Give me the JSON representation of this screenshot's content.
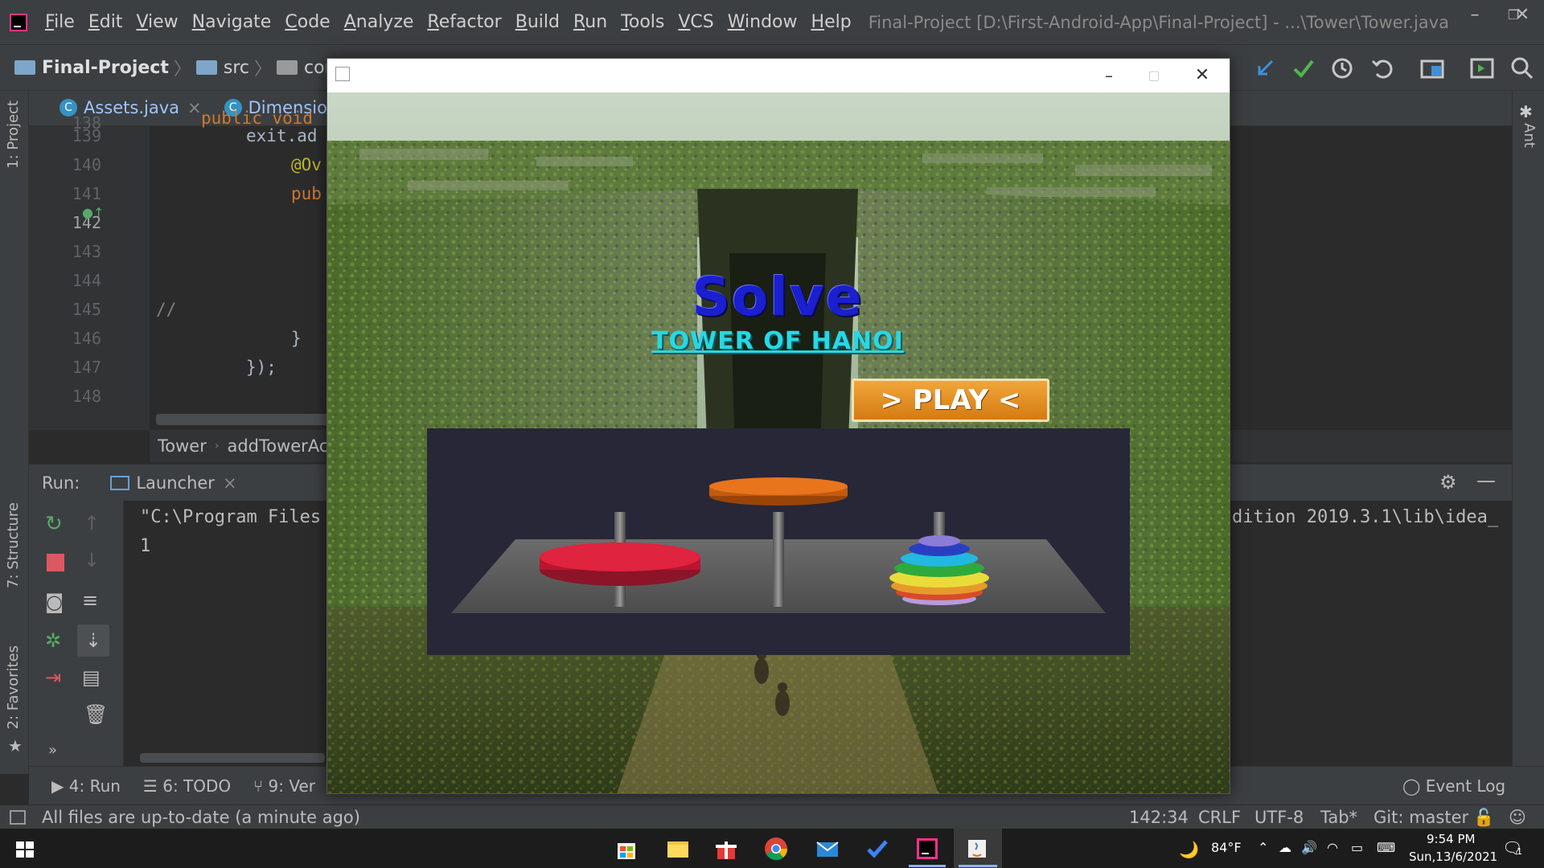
{
  "ide": {
    "menu": [
      "File",
      "Edit",
      "View",
      "Navigate",
      "Code",
      "Analyze",
      "Refactor",
      "Build",
      "Run",
      "Tools",
      "VCS",
      "Window",
      "Help"
    ],
    "window_title": "Final-Project [D:\\First-Android-App\\Final-Project] - ...\\Tower\\Tower.java",
    "breadcrumbs": [
      "Final-Project",
      "src",
      "com"
    ],
    "editor_tabs": [
      {
        "label": "Assets.java",
        "close": "×"
      },
      {
        "label": "Dimension.ja"
      }
    ],
    "line_numbers": [
      "138",
      "139",
      "140",
      "141",
      "142",
      "143",
      "144",
      "145",
      "146",
      "147",
      "148"
    ],
    "code_lines": [
      "public void",
      "exit.ad",
      "@Ov",
      "pub",
      "",
      "",
      "",
      "//",
      "}",
      "});",
      ""
    ],
    "code_breadcrumb": [
      "Tower",
      "addTowerAc"
    ],
    "run": {
      "label": "Run:",
      "config_tab": "Launcher",
      "output_line1_left": "\"C:\\Program Files",
      "output_line1_right": "dition 2019.3.1\\lib\\idea_",
      "output_line2": "1"
    },
    "tool_tabs": [
      "4: Run",
      "6: TODO",
      "9: Ver"
    ],
    "event_log": "Event Log",
    "side_labels": {
      "project": "1: Project",
      "structure": "7: Structure",
      "favorites": "2: Favorites",
      "ant": "Ant"
    },
    "status": {
      "message": "All files are up-to-date (a minute ago)",
      "position": "142:34",
      "line_sep": "CRLF",
      "encoding": "UTF-8",
      "indent": "Tab*",
      "git": "Git: master"
    }
  },
  "game": {
    "title": "Solve",
    "subtitle": "TOWER OF HANOI",
    "play_label": "> PLAY <",
    "disc_colors": {
      "left_disc": "#d81e3c",
      "top_disc": "#e06a14",
      "stack": [
        "#8d7cd6",
        "#2a3fbf",
        "#22b8e0",
        "#2eaa3c",
        "#e8dc3a",
        "#e69a2a",
        "#d84a2a",
        "#b89adf"
      ]
    }
  },
  "taskbar": {
    "weather": "84°F",
    "time": "9:54 PM",
    "date": "Sun,13/6/2021",
    "notifications": "1"
  }
}
